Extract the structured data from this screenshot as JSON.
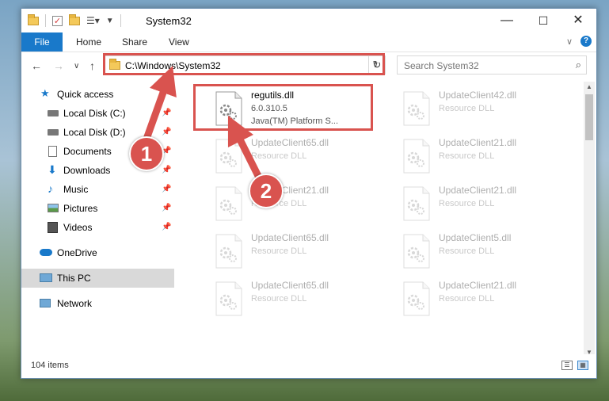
{
  "window": {
    "title": "System32",
    "controls": {
      "minimize": "—",
      "maximize": "☐",
      "close": "✕"
    }
  },
  "ribbon": {
    "tabs": [
      "File",
      "Home",
      "Share",
      "View"
    ],
    "collapse_glyph": "∨",
    "help_glyph": "?"
  },
  "nav": {
    "back": "←",
    "forward": "→",
    "recent": "∨",
    "up": "↑",
    "address": "C:\\Windows\\System32",
    "address_drop": "∨",
    "refresh": "↻",
    "search_placeholder": "Search System32"
  },
  "sidebar": {
    "items": [
      {
        "label": "Quick access",
        "icon": "star-icon",
        "pinned": false
      },
      {
        "label": "Local Disk (C:)",
        "icon": "drive-icon",
        "pinned": true
      },
      {
        "label": "Local Disk (D:)",
        "icon": "drive-icon",
        "pinned": true
      },
      {
        "label": "Documents",
        "icon": "documents-icon",
        "pinned": true
      },
      {
        "label": "Downloads",
        "icon": "download-icon",
        "pinned": true
      },
      {
        "label": "Music",
        "icon": "music-icon",
        "pinned": true
      },
      {
        "label": "Pictures",
        "icon": "pictures-icon",
        "pinned": true
      },
      {
        "label": "Videos",
        "icon": "videos-icon",
        "pinned": true
      },
      {
        "label": "OneDrive",
        "icon": "cloud-icon",
        "pinned": false
      },
      {
        "label": "This PC",
        "icon": "computer-icon",
        "pinned": false,
        "selected": true
      },
      {
        "label": "Network",
        "icon": "network-icon",
        "pinned": false
      }
    ]
  },
  "files": [
    {
      "name": "regutils.dll",
      "line2": "6.0.310.5",
      "line3": "Java(TM) Platform S...",
      "faded": false
    },
    {
      "name": "UpdateClient42.dll",
      "line2": "Resource DLL",
      "faded": true
    },
    {
      "name": "UpdateClient65.dll",
      "line2": "Resource DLL",
      "faded": true
    },
    {
      "name": "UpdateClient21.dll",
      "line2": "Resource DLL",
      "faded": true
    },
    {
      "name": "UpdateClient21.dll",
      "line2": "Resource DLL",
      "faded": true
    },
    {
      "name": "UpdateClient21.dll",
      "line2": "Resource DLL",
      "faded": true
    },
    {
      "name": "UpdateClient65.dll",
      "line2": "Resource DLL",
      "faded": true
    },
    {
      "name": "UpdateClient5.dll",
      "line2": "Resource DLL",
      "faded": true
    },
    {
      "name": "UpdateClient65.dll",
      "line2": "Resource DLL",
      "faded": true
    },
    {
      "name": "UpdateClient21.dll",
      "line2": "Resource DLL",
      "faded": true
    }
  ],
  "status": {
    "item_count": "104 items"
  },
  "callouts": [
    "1",
    "2"
  ],
  "colors": {
    "accent": "#1979ca",
    "highlight": "#d9534f",
    "selected": "#d9d9d9"
  }
}
